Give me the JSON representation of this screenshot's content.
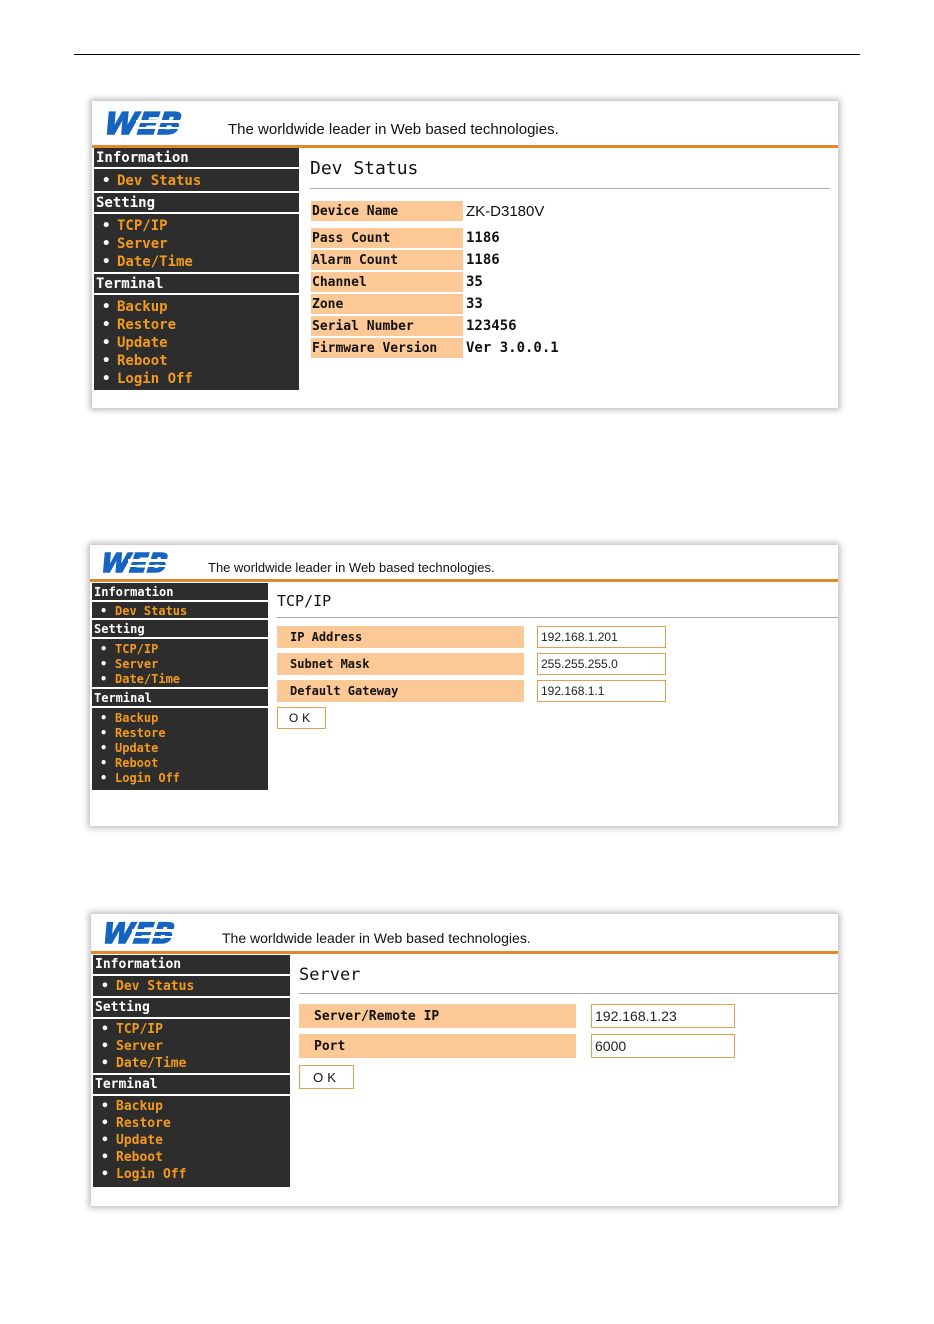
{
  "header": {
    "logo_text": "WEB",
    "tagline": "The worldwide leader in Web based technologies."
  },
  "sidebar": {
    "information": "Information",
    "dev_status": "Dev Status",
    "setting": "Setting",
    "tcpip": "TCP/IP",
    "server": "Server",
    "datetime": "Date/Time",
    "terminal": "Terminal",
    "backup": "Backup",
    "restore": "Restore",
    "update": "Update",
    "reboot": "Reboot",
    "login_off": "Login Off",
    "bullet": "•"
  },
  "devstatus": {
    "title": "Dev Status",
    "rows": [
      {
        "label": "Device Name",
        "value": "ZK-D3180V"
      },
      {
        "label": "Pass Count",
        "value": "1186"
      },
      {
        "label": "Alarm Count",
        "value": "1186"
      },
      {
        "label": "Channel",
        "value": "35"
      },
      {
        "label": "Zone",
        "value": "33"
      },
      {
        "label": "Serial Number",
        "value": "123456"
      },
      {
        "label": "Firmware Version",
        "value": "Ver 3.0.0.1"
      }
    ]
  },
  "tcpip": {
    "title": "TCP/IP",
    "rows": [
      {
        "label": "IP Address",
        "value": "192.168.1.201"
      },
      {
        "label": "Subnet Mask",
        "value": "255.255.255.0"
      },
      {
        "label": "Default Gateway",
        "value": "192.168.1.1"
      }
    ],
    "ok": "OK"
  },
  "server": {
    "title": "Server",
    "rows": [
      {
        "label": "Server/Remote IP",
        "value": "192.168.1.23"
      },
      {
        "label": "Port",
        "value": "6000"
      }
    ],
    "ok": "OK"
  },
  "colors": {
    "accent_orange": "#f39a1c",
    "label_bg": "#fcc896",
    "sidebar_bg": "#2d2d2d",
    "logo_blue": "#1565c0"
  }
}
